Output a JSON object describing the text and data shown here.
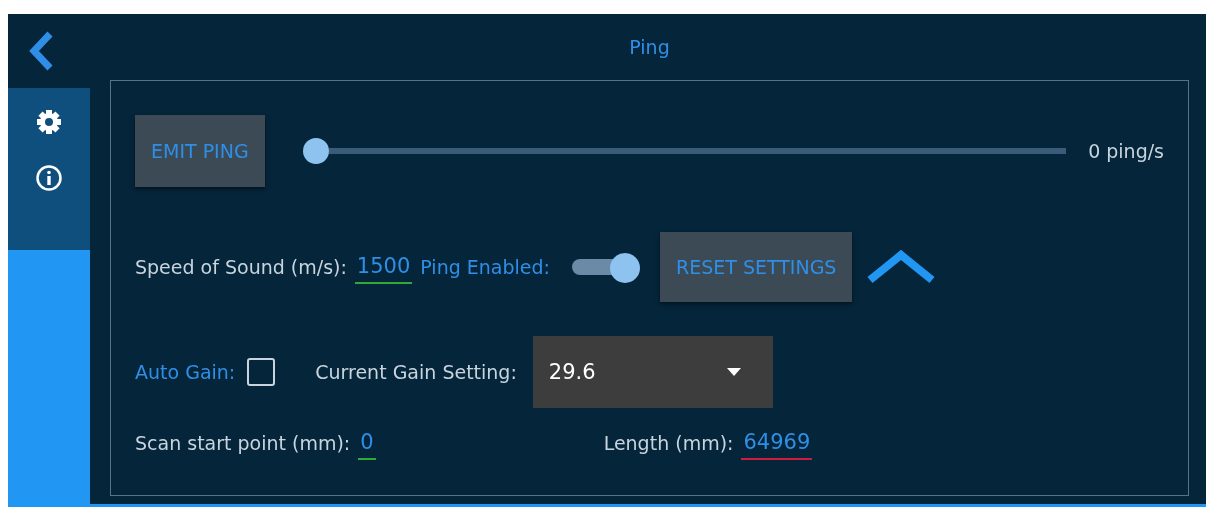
{
  "header": {
    "title": "Ping"
  },
  "sidebar": {
    "items": [
      {
        "kind": "settings"
      },
      {
        "kind": "info"
      }
    ]
  },
  "ping": {
    "button": "EMIT PING",
    "rate": {
      "level": 0,
      "reading": "0 ping/s"
    }
  },
  "speed": {
    "label": "Speed of Sound (m/s):",
    "value": "1500",
    "valid": true
  },
  "ping_enabled": {
    "label": "Ping Enabled:",
    "on": true
  },
  "reset": "RESET SETTINGS",
  "auto_gain": {
    "label": "Auto Gain:",
    "checked": false
  },
  "gain": {
    "label": "Current Gain Setting:",
    "value": "29.6"
  },
  "scan_start": {
    "label": "Scan start point (mm):",
    "value": "0",
    "valid": true
  },
  "length": {
    "label": "Length (mm):",
    "value": "64969",
    "valid": false
  }
}
